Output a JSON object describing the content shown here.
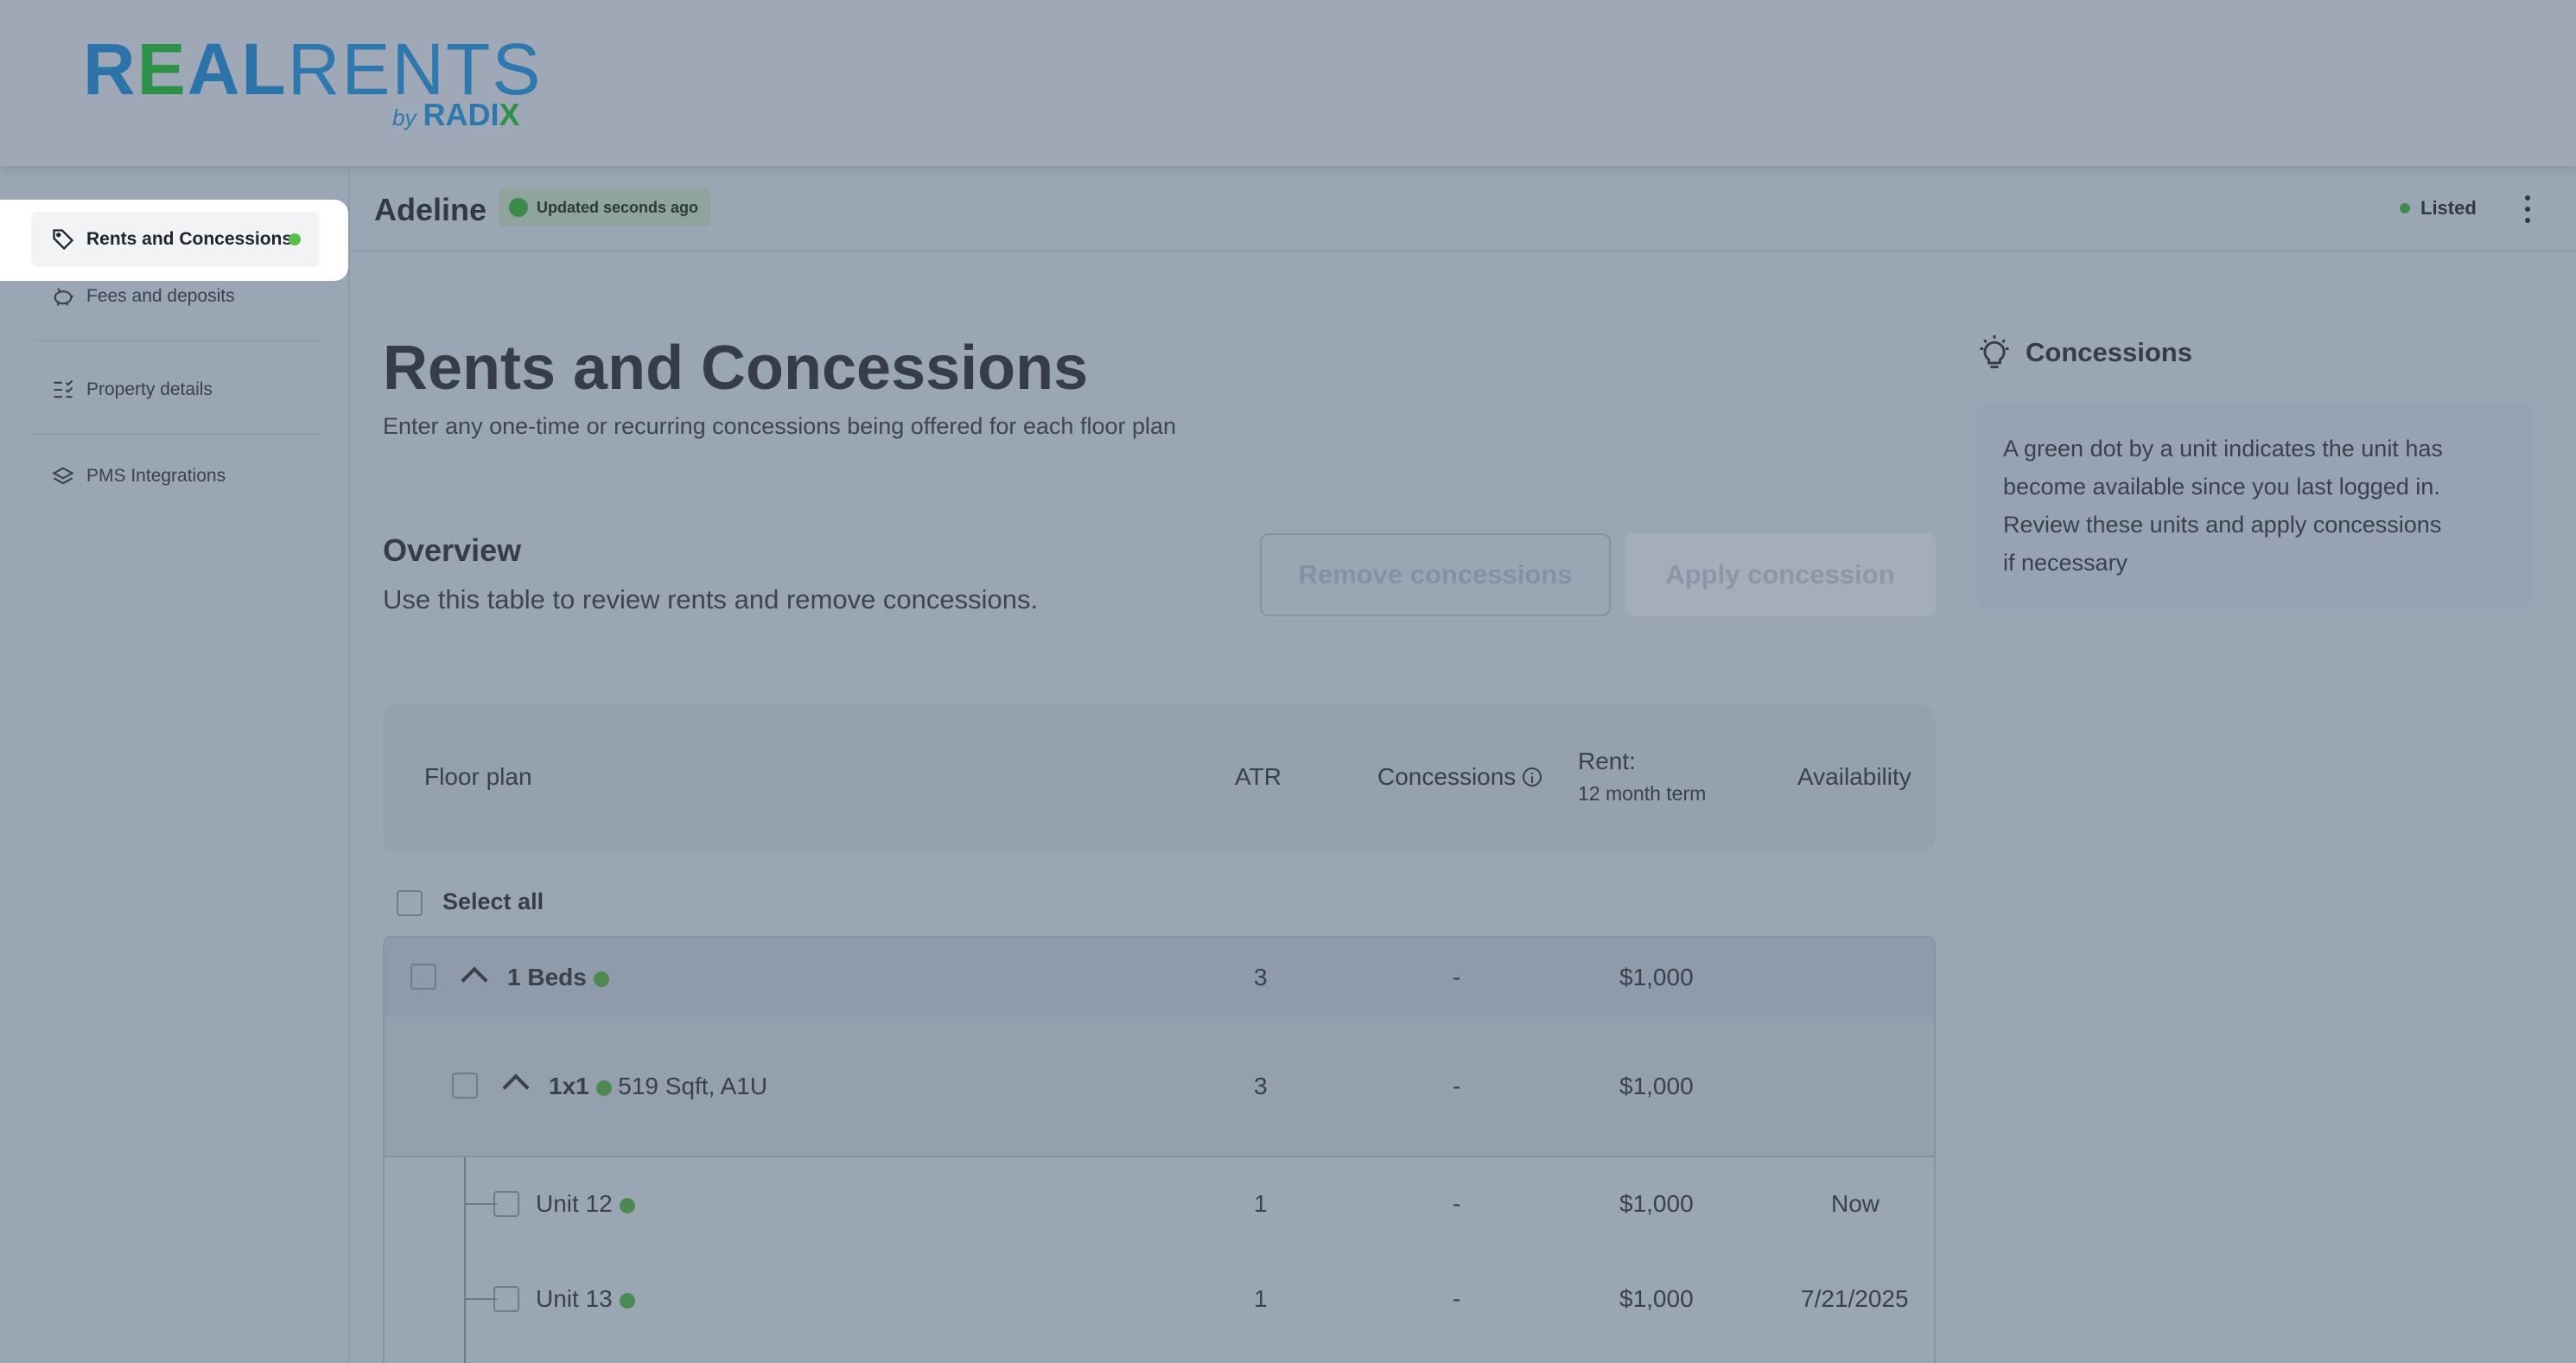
{
  "brand": {
    "logo_alt": "REALRENTS by RADIX",
    "real": "R",
    "real_e": "E",
    "real_al": "AL",
    "rents": "RENTS",
    "by": "by",
    "radix_a": "RADI",
    "radix_x": "X"
  },
  "sidebar": {
    "items": [
      {
        "label": "Rents and Concessions",
        "icon": "tag-icon",
        "active": true,
        "has_dot": true
      },
      {
        "label": "Fees and deposits",
        "icon": "piggy-bank-icon"
      },
      {
        "label": "Property details",
        "icon": "checklist-icon"
      },
      {
        "label": "PMS Integrations",
        "icon": "layers-icon"
      }
    ]
  },
  "header": {
    "property_name": "Adeline",
    "updated_badge": "Updated seconds ago",
    "status": "Listed",
    "status_color": "#3d8d4a"
  },
  "main": {
    "title": "Rents and Concessions",
    "subtitle": "Enter any one-time or recurring concessions being offered for each floor plan",
    "overview_title": "Overview",
    "overview_subtitle": "Use this table to review rents and remove concessions.",
    "remove_button": "Remove concessions",
    "apply_button": "Apply concession"
  },
  "table": {
    "columns": {
      "floor_plan": "Floor plan",
      "atr": "ATR",
      "concessions": "Concessions",
      "rent": "Rent:",
      "rent_sub": "12 month term",
      "availability": "Availability"
    },
    "select_all": "Select all",
    "group": {
      "label": "1 Beds",
      "atr": "3",
      "concessions": "-",
      "rent": "$1,000"
    },
    "floorplan": {
      "label": "1x1",
      "detail": "519 Sqft, A1U",
      "atr": "3",
      "concessions": "-",
      "rent": "$1,000"
    },
    "units": [
      {
        "label": "Unit 12",
        "atr": "1",
        "concessions": "-",
        "rent": "$1,000",
        "availability": "Now"
      },
      {
        "label": "Unit 13",
        "atr": "1",
        "concessions": "-",
        "rent": "$1,000",
        "availability": "7/21/2025"
      }
    ]
  },
  "tip": {
    "title": "Concessions",
    "icon": "lightbulb-icon",
    "lines": [
      "A green dot by a unit indicates the unit has",
      "become available since you last logged in.",
      "Review these units and apply concessions",
      "if necessary"
    ]
  },
  "colors": {
    "new_dot": "#58c04a",
    "overlay": "#9ba6b5",
    "brand_blue": "#2f78ad",
    "brand_green": "#2e9148"
  }
}
